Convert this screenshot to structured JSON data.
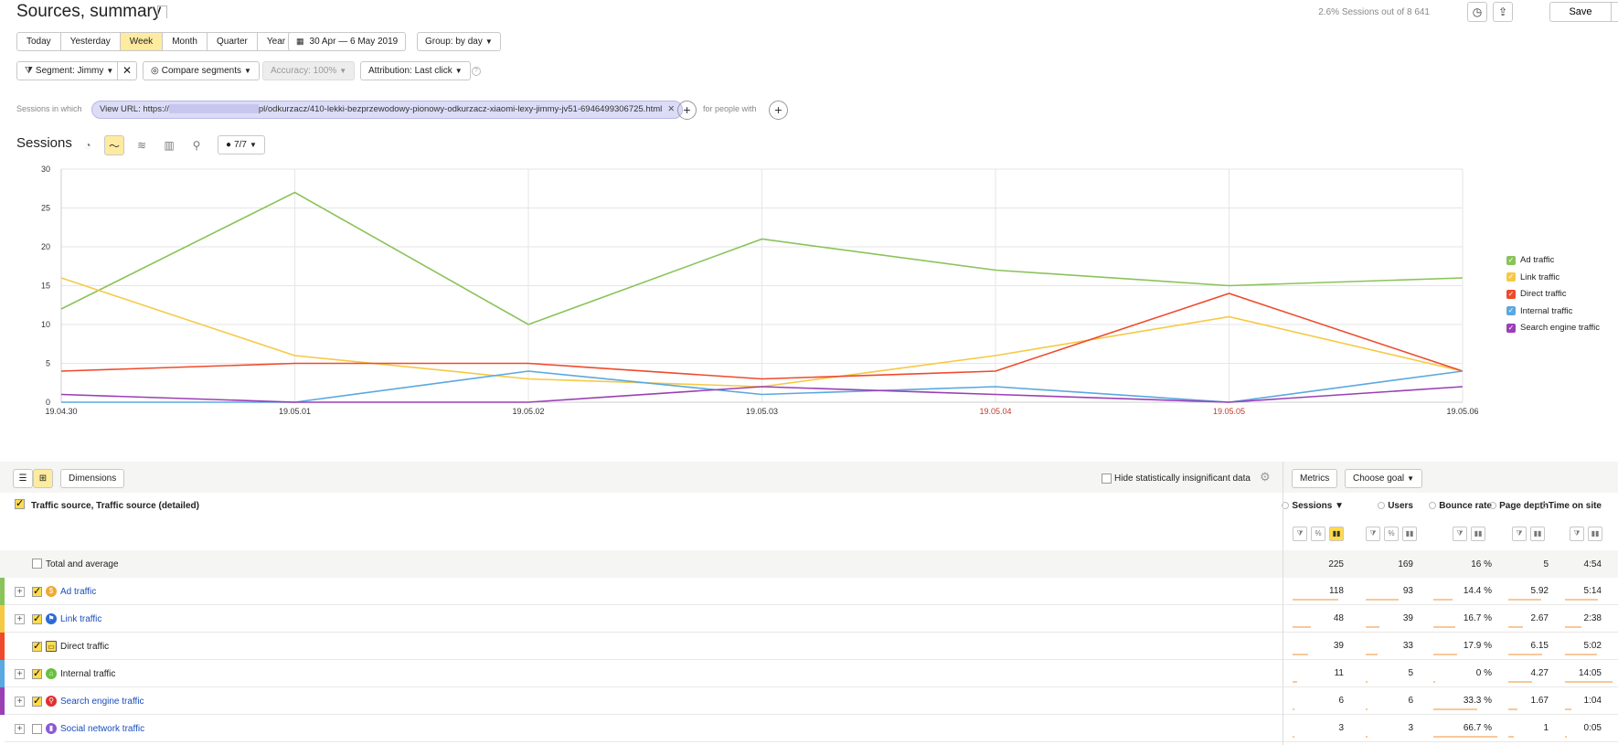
{
  "header": {
    "title": "Sources, summary",
    "stat": "2.6% Sessions out of 8 641",
    "save_label": "Save"
  },
  "periods": {
    "items": [
      "Today",
      "Yesterday",
      "Week",
      "Month",
      "Quarter",
      "Year"
    ],
    "active": "Week"
  },
  "date_range": "30 Apr — 6 May 2019",
  "group": "Group: by day",
  "filters": {
    "segment": "Segment: Jimmy",
    "compare": "Compare segments",
    "accuracy": "Accuracy: 100%",
    "attribution": "Attribution: Last click"
  },
  "sessions_filter": {
    "label": "Sessions in which",
    "chip_prefix": "View URL: https://",
    "chip_suffix": "pl/odkurzacz/410-lekki-bezprzewodowy-pionowy-odkurzacz-xiaomi-lexy-jimmy-jv51-6946499306725.html",
    "people_label": "for people with"
  },
  "chart_section": {
    "title": "Sessions",
    "series_count": "7/7"
  },
  "chart_data": {
    "type": "line",
    "x": [
      "19.04.30",
      "19.05.01",
      "19.05.02",
      "19.05.03",
      "19.05.04",
      "19.05.05",
      "19.05.06"
    ],
    "weekend_x": [
      "19.05.04",
      "19.05.05"
    ],
    "ylim": [
      0,
      30
    ],
    "yticks": [
      0,
      5,
      10,
      15,
      20,
      25,
      30
    ],
    "grid": true,
    "legend_position": "right",
    "series": [
      {
        "name": "Ad traffic",
        "color": "#8ac35a",
        "values": [
          12,
          27,
          10,
          21,
          17,
          15,
          16
        ]
      },
      {
        "name": "Link traffic",
        "color": "#f6c944",
        "values": [
          16,
          6,
          3,
          2,
          6,
          11,
          4
        ]
      },
      {
        "name": "Direct traffic",
        "color": "#ef4a2b",
        "values": [
          4,
          5,
          5,
          3,
          4,
          14,
          4
        ]
      },
      {
        "name": "Internal traffic",
        "color": "#5aa8e0",
        "values": [
          0,
          0,
          4,
          1,
          2,
          0,
          4
        ]
      },
      {
        "name": "Search engine traffic",
        "color": "#9b3fb5",
        "values": [
          1,
          0,
          0,
          2,
          1,
          0,
          2
        ]
      }
    ]
  },
  "table_toolbar": {
    "dimensions": "Dimensions",
    "hide_insignificant": "Hide statistically insignificant data",
    "metrics": "Metrics",
    "choose_goal": "Choose goal"
  },
  "table": {
    "group_header": "Traffic source, Traffic source (detailed)",
    "columns": [
      "Sessions ▼",
      "Users",
      "Bounce rate",
      "Page depth",
      "Time on site"
    ],
    "total": {
      "label": "Total and average",
      "values": [
        "225",
        "169",
        "16 %",
        "5",
        "4:54"
      ]
    },
    "rows": [
      {
        "label": "Ad traffic",
        "color": "#8ac35a",
        "icon_color": "#f0a830",
        "icon": "$",
        "link": true,
        "expand": true,
        "checked": true,
        "values": [
          "118",
          "93",
          "14.4 %",
          "5.92",
          "5:14"
        ],
        "bars": [
          0.84,
          0.66,
          0.3,
          0.8,
          0.7
        ]
      },
      {
        "label": "Link traffic",
        "color": "#f6c944",
        "icon_color": "#2c6bd6",
        "icon": "⚑",
        "link": true,
        "expand": true,
        "checked": true,
        "values": [
          "48",
          "39",
          "16.7 %",
          "2.67",
          "2:38"
        ],
        "bars": [
          0.34,
          0.28,
          0.34,
          0.36,
          0.35
        ]
      },
      {
        "label": "Direct traffic",
        "color": "#ef4a2b",
        "icon_color": "#555",
        "icon": "▭",
        "link": false,
        "expand": false,
        "checked": true,
        "values": [
          "39",
          "33",
          "17.9 %",
          "6.15",
          "5:02"
        ],
        "bars": [
          0.28,
          0.24,
          0.37,
          0.83,
          0.67
        ]
      },
      {
        "label": "Internal traffic",
        "color": "#5aa8e0",
        "icon_color": "#6abf3f",
        "icon": "⌂",
        "link": false,
        "expand": true,
        "checked": true,
        "values": [
          "11",
          "5",
          "0 %",
          "4.27",
          "14:05"
        ],
        "bars": [
          0.08,
          0.04,
          0,
          0.58,
          1
        ]
      },
      {
        "label": "Search engine traffic",
        "color": "#9b3fb5",
        "icon_color": "#e03030",
        "icon": "⚲",
        "link": true,
        "expand": true,
        "checked": true,
        "values": [
          "6",
          "6",
          "33.3 %",
          "1.67",
          "1:04"
        ],
        "bars": [
          0.04,
          0.04,
          0.68,
          0.23,
          0.14
        ]
      },
      {
        "label": "Social network traffic",
        "color": "#ffffff",
        "icon_color": "#8a5ad6",
        "icon": "▮",
        "link": true,
        "expand": true,
        "checked": false,
        "values": [
          "3",
          "3",
          "66.7 %",
          "1",
          "0:05"
        ],
        "bars": [
          0.02,
          0.02,
          1,
          0.14,
          0.01
        ]
      }
    ]
  }
}
